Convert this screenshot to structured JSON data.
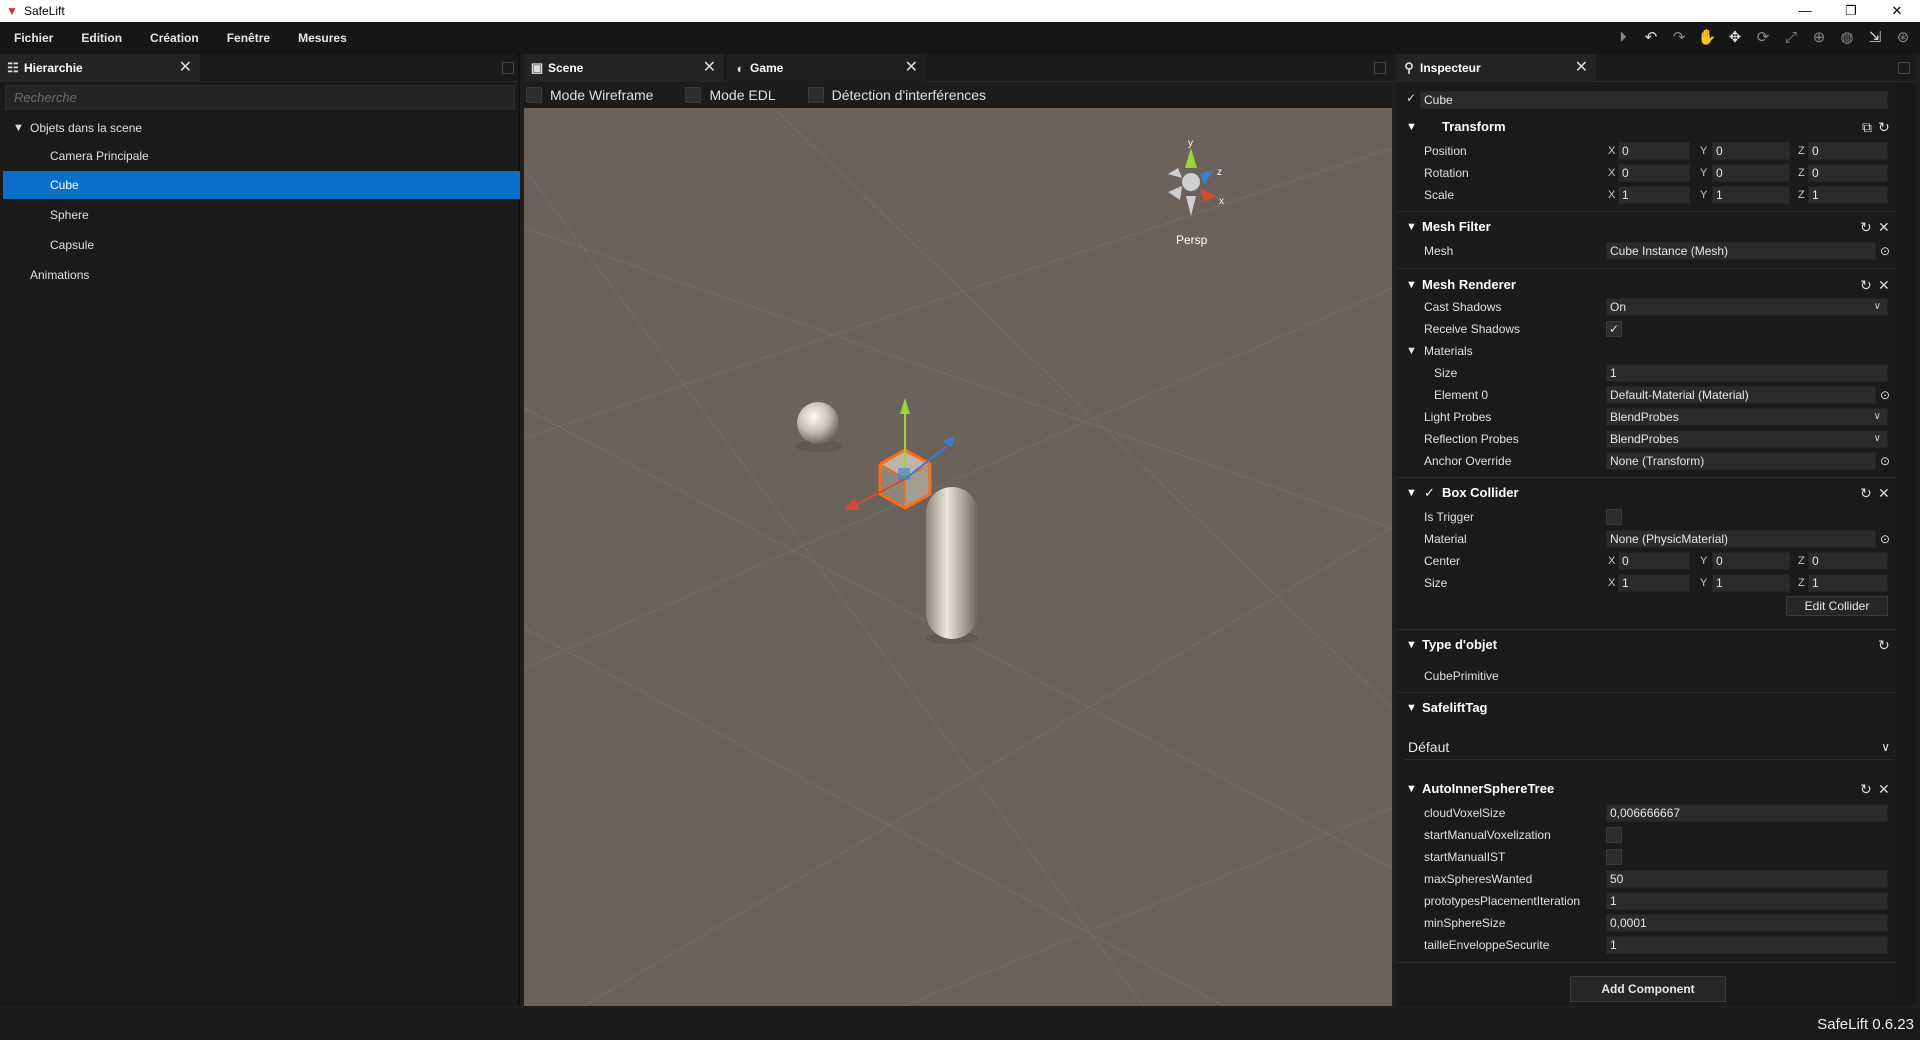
{
  "window": {
    "title": "SafeLift",
    "minimize": "—",
    "restore": "❐",
    "close": "✕"
  },
  "menu": [
    "Fichier",
    "Edition",
    "Création",
    "Fenêtre",
    "Mesures"
  ],
  "toolbar_icons": [
    "play-icon",
    "undo-icon",
    "redo-icon",
    "hand-icon",
    "move-icon",
    "rotate-icon",
    "scale-icon",
    "rect-icon",
    "globe-icon",
    "pivot-icon",
    "settings-icon"
  ],
  "hierarchy": {
    "tab": "Hierarchie",
    "search_placeholder": "Recherche",
    "root": "Objets dans la scene",
    "children": [
      "Camera Principale",
      "Cube",
      "Sphere",
      "Capsule"
    ],
    "selected": "Cube",
    "other": "Animations"
  },
  "scene": {
    "tabs": [
      "Scene",
      "Game"
    ],
    "options": [
      "Mode Wireframe",
      "Mode EDL",
      "Détection d'interférences"
    ],
    "gizmo": {
      "y": "y",
      "z": "z",
      "x": "x",
      "view": "Persp"
    }
  },
  "inspector": {
    "tab": "Inspecteur",
    "object_name": "Cube",
    "transform": {
      "title": "Transform",
      "rows": [
        {
          "label": "Position",
          "x": "0",
          "y": "0",
          "z": "0"
        },
        {
          "label": "Rotation",
          "x": "0",
          "y": "0",
          "z": "0"
        },
        {
          "label": "Scale",
          "x": "1",
          "y": "1",
          "z": "1"
        }
      ]
    },
    "mesh_filter": {
      "title": "Mesh Filter",
      "mesh_label": "Mesh",
      "mesh_value": "Cube Instance (Mesh)"
    },
    "mesh_renderer": {
      "title": "Mesh Renderer",
      "cast_shadows_label": "Cast Shadows",
      "cast_shadows": "On",
      "receive_shadows_label": "Receive Shadows",
      "materials_label": "Materials",
      "size_label": "Size",
      "size": "1",
      "element0_label": "Element 0",
      "element0": "Default-Material (Material)",
      "light_probes_label": "Light Probes",
      "light_probes": "BlendProbes",
      "reflection_probes_label": "Reflection Probes",
      "reflection_probes": "BlendProbes",
      "anchor_label": "Anchor Override",
      "anchor": "None (Transform)"
    },
    "box_collider": {
      "title": "Box Collider",
      "is_trigger_label": "Is Trigger",
      "material_label": "Material",
      "material": "None (PhysicMaterial)",
      "center_label": "Center",
      "center": {
        "x": "0",
        "y": "0",
        "z": "0"
      },
      "size_label": "Size",
      "size": {
        "x": "1",
        "y": "1",
        "z": "1"
      },
      "edit_button": "Edit Collider"
    },
    "type_objet": {
      "title": "Type d'objet",
      "value": "CubePrimitive"
    },
    "safelift_tag": {
      "title": "SafeliftTag",
      "value": "Défaut"
    },
    "auto_ist": {
      "title": "AutoInnerSphereTree",
      "rows": [
        {
          "label": "cloudVoxelSize",
          "value": "0,006666667"
        },
        {
          "label": "startManualVoxelization",
          "value": ""
        },
        {
          "label": "startManualIST",
          "value": ""
        },
        {
          "label": "maxSpheresWanted",
          "value": "50"
        },
        {
          "label": "prototypesPlacementIteration",
          "value": "1"
        },
        {
          "label": "minSphereSize",
          "value": "0,0001"
        },
        {
          "label": "tailleEnveloppeSecurite",
          "value": "1"
        }
      ]
    },
    "add_component": "Add Component"
  },
  "axis": {
    "x": "X",
    "y": "Y",
    "z": "Z"
  },
  "status": {
    "version": "SafeLift 0.6.23"
  },
  "colors": {
    "selection": "#0a6fc6",
    "viewport": "#6b625c",
    "panel": "#1a1a1a"
  }
}
